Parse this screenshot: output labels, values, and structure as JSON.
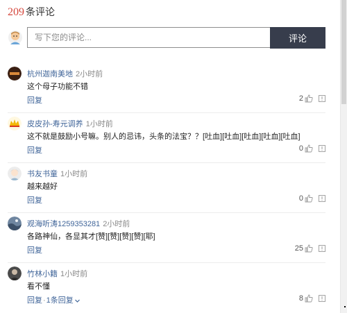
{
  "header": {
    "count": "209",
    "label": "条评论"
  },
  "composer": {
    "placeholder": "写下您的评论...",
    "submit_label": "评论"
  },
  "comments": [
    {
      "user": "杭州迦南美地",
      "time": "2小时前",
      "text": "这个母子功能不错",
      "reply_label": "回复",
      "likes": "2"
    },
    {
      "user": "皮皮孙-寿元调养",
      "time": "1小时前",
      "text": "这不就是鼓励小号嘛。别人的忌讳，头条的法宝？？[吐血][吐血][吐血][吐血][吐血]",
      "reply_label": "回复",
      "likes": "0"
    },
    {
      "user": "书友书童",
      "time": "1小时前",
      "text": "越来越好",
      "reply_label": "回复",
      "likes": "0"
    },
    {
      "user": "观海听涛1259353281",
      "time": "2小时前",
      "text": "各路神仙，各显其才[赞][赞][赞][赞][耶]",
      "reply_label": "回复",
      "likes": "25"
    },
    {
      "user": "竹林小籍",
      "time": "1小时前",
      "text": "看不懂",
      "reply_label": "回复",
      "more_replies": "1条回复",
      "likes": "8"
    }
  ],
  "colors": {
    "accent_red": "#d5473d",
    "link_blue": "#406599",
    "button_dark": "#373d4c"
  }
}
